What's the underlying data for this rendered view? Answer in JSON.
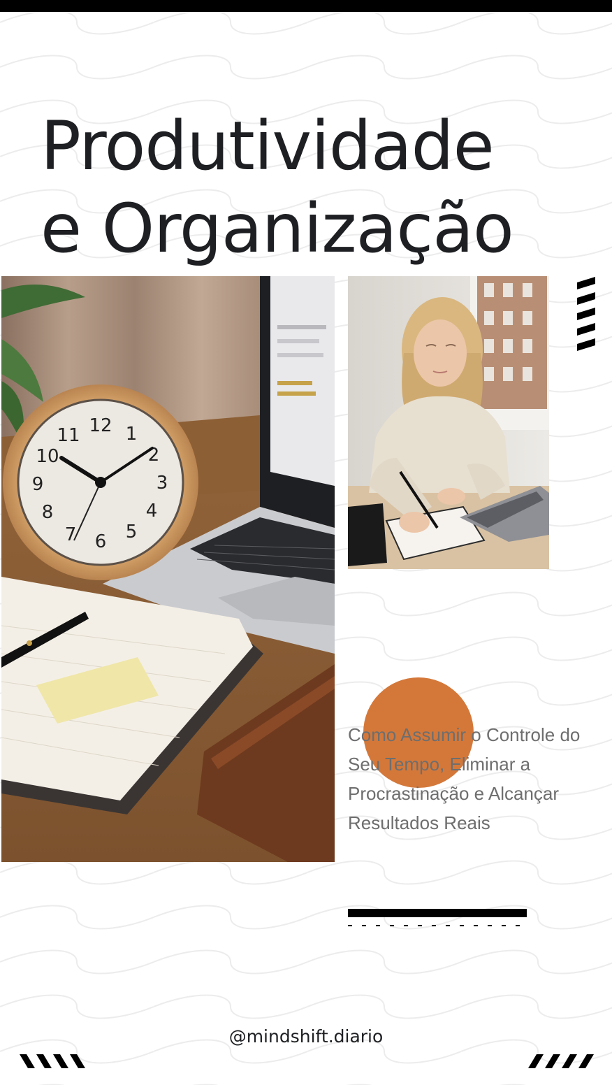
{
  "title": {
    "line1": "Produtividade",
    "line2": "e Organização"
  },
  "subtitle": "Como Assumir o Controle do Seu Tempo, Eliminar a Procrastinação e Alcançar Resultados Reais",
  "footer": {
    "handle": "@mindshift.diario"
  },
  "images": {
    "desk_photo": "desk-clock-laptop-notebook-photo",
    "woman_photo": "woman-writing-notebook-photo"
  },
  "colors": {
    "accent": "#d4783a",
    "text": "#1d1f22",
    "subtitle": "#6e6e6e",
    "background": "#ffffff"
  }
}
